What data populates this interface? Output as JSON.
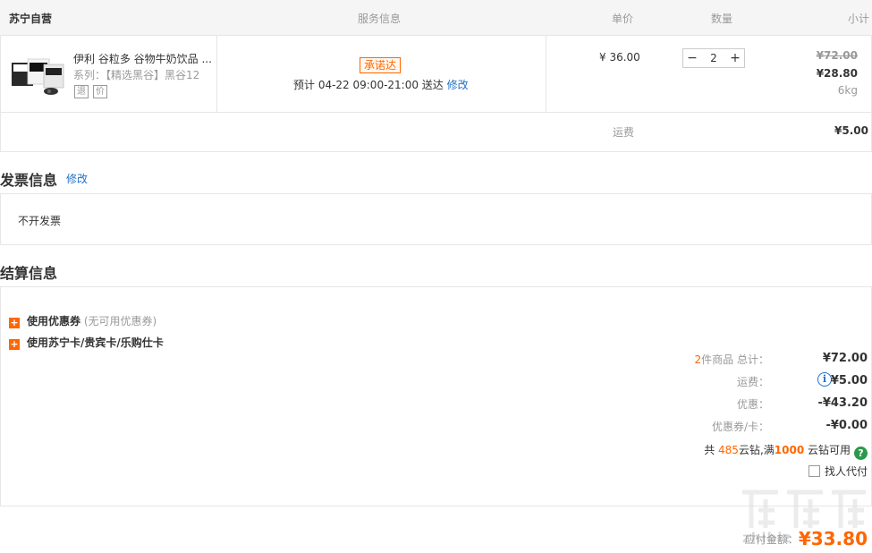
{
  "header": {
    "store": "苏宁自营",
    "service": "服务信息",
    "unit_price": "单价",
    "quantity": "数量",
    "subtotal": "小计"
  },
  "product": {
    "name": "伊利 谷粒多 谷物牛奶饮品 ...",
    "series": "系列：【精选黑谷】黑谷12",
    "tags": [
      "退",
      "价"
    ],
    "promise_badge": "承诺达",
    "delivery_prefix": "预计  04-22  09:00-21:00  送达",
    "delivery_edit": "修改",
    "unit_price": "¥ 36.00",
    "qty": "2",
    "subtotal_original": "¥72.00",
    "subtotal_final": "¥28.80",
    "weight": "6kg"
  },
  "shipping": {
    "label": "运费",
    "value": "¥5.00"
  },
  "invoice": {
    "title": "发票信息",
    "edit": "修改",
    "value": "不开发票"
  },
  "settlement": {
    "title": "结算信息",
    "coupon_label": "使用优惠券",
    "coupon_hint": "(无可用优惠券)",
    "card_label": "使用苏宁卡/贵宾卡/乐购仕卡",
    "summary": {
      "items_count": "2",
      "items_label": "件商品 总计：",
      "items_total": "¥72.00",
      "freight_label": "运费：",
      "freight_value": "¥5.00",
      "discount_label": "优惠：",
      "discount_value": "-¥43.20",
      "coupon_card_label": "优惠券/卡：",
      "coupon_card_value": "-¥0.00"
    },
    "cloud": {
      "prefix": "共 ",
      "count": "485",
      "mid": "云钻,满",
      "threshold": "1000",
      "suffix": " 云钻可用"
    },
    "proxy_pay": "找人代付",
    "payable_label": "应付金额：",
    "payable_value": "¥33.80"
  },
  "watermark": {
    "text": "zhibiz"
  },
  "colors": {
    "accent": "#ff6600",
    "link": "#2272c8",
    "help": "#2a9a4a"
  }
}
